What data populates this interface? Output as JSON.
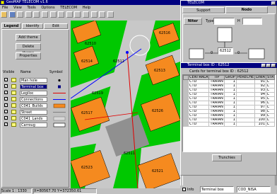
{
  "main_window": {
    "title": "GeoMAP TELECOM v1.6",
    "menu": [
      "File",
      "View",
      "Tools",
      "Options",
      "TELECOM",
      "Help"
    ],
    "panel_tabs": [
      "Legend",
      "Identify",
      "Edit"
    ],
    "buttons": {
      "add": "Add theme",
      "delete": "Delete theme",
      "properties": "Properties"
    },
    "legend_headers": {
      "visible": "Visible",
      "name": "Name",
      "symbol": "Symbol"
    },
    "layers": [
      {
        "name": "Man hole",
        "visible": true,
        "selected": false,
        "symbol": "dot"
      },
      {
        "name": "Terminal box",
        "visible": true,
        "selected": true,
        "symbol": "square"
      },
      {
        "name": "Legiloc",
        "visible": true,
        "selected": false,
        "symbol": "redline"
      },
      {
        "name": "Connections",
        "visible": true,
        "selected": false,
        "symbol": "blueline"
      },
      {
        "name": "C041_Builds",
        "visible": true,
        "selected": false,
        "symbol": "orange"
      },
      {
        "name": "Street",
        "visible": true,
        "selected": false,
        "symbol": "greyline"
      },
      {
        "name": "C041_Lands",
        "visible": true,
        "selected": false,
        "symbol": "lightgrey"
      },
      {
        "name": "Carroug",
        "visible": true,
        "selected": false,
        "symbol": "white"
      }
    ]
  },
  "status_bar": {
    "scale": "Scale 1 : 1330",
    "coords": "X=80567.70 Y=372350.61",
    "info_label": "Info",
    "layer_combo": "Terminal box",
    "code_combo": "COD_NISA"
  },
  "map_labels": [
    "62512",
    "62510",
    "62516",
    "62514",
    "62513",
    "62519",
    "62517",
    "62526",
    "62511",
    "62523",
    "62521"
  ],
  "telecom_window": {
    "title": "TELECOM",
    "tabs": [
      "Support",
      "Nodo"
    ],
    "niter_label": "Niter",
    "type_label": "Type",
    "h_label": "H",
    "node_id": "62512",
    "left_value": "0",
    "right_value": "0"
  },
  "terminal_window": {
    "title": "Terminal box ID : 62512",
    "caption": "Cards for terminal box ID : 62512",
    "columns": [
      "CENTRALA",
      "TIP",
      "GRUP",
      "PERECHE",
      "LINIA",
      "STA"
    ],
    "rows": [
      [
        "CTD",
        "TRAIAN",
        "1",
        "",
        "91",
        "L"
      ],
      [
        "CTD",
        "TRAIAN",
        "1",
        "",
        "92",
        "L"
      ],
      [
        "CTD",
        "TRAIAN",
        "1",
        "",
        "93",
        "L"
      ],
      [
        "CTD",
        "TRAIAN",
        "1",
        "",
        "94",
        "L"
      ],
      [
        "CTD",
        "TRAIAN",
        "1",
        "",
        "95",
        "L"
      ],
      [
        "CTD",
        "TRAIAN",
        "1",
        "",
        "96",
        "L"
      ],
      [
        "CTD",
        "TRAIAN",
        "1",
        "",
        "97",
        "L"
      ],
      [
        "CTD",
        "TRAIAN",
        "1",
        "",
        "98",
        "L"
      ],
      [
        "CTD",
        "TRAIAN",
        "1",
        "",
        "99",
        "L"
      ],
      [
        "CTD",
        "TRAIAN",
        "1",
        "",
        "100",
        "L"
      ],
      [
        "CTD",
        "TRAIAN",
        "1",
        "",
        "101",
        "L"
      ]
    ],
    "button": "Trunchies"
  },
  "colors": {
    "title_bar": "#000080",
    "building": "#f58a1f",
    "land": "#00c800",
    "street": "#c8c8c8",
    "window": "#c0c0c0"
  }
}
